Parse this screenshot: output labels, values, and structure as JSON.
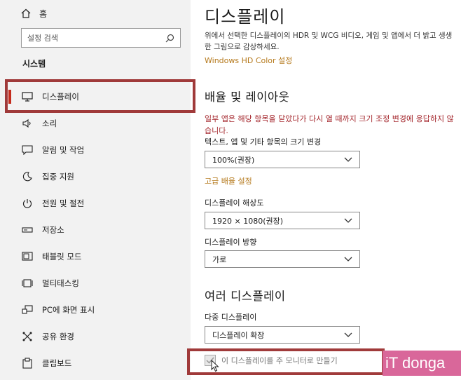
{
  "sidebar": {
    "home_label": "홈",
    "search_placeholder": "설정 검색",
    "section_title": "시스템",
    "items": [
      {
        "label": "디스플레이",
        "icon": "monitor-icon"
      },
      {
        "label": "소리",
        "icon": "speaker-icon"
      },
      {
        "label": "알림 및 작업",
        "icon": "notification-icon"
      },
      {
        "label": "집중 지원",
        "icon": "moon-icon"
      },
      {
        "label": "전원 및 절전",
        "icon": "power-icon"
      },
      {
        "label": "저장소",
        "icon": "storage-icon"
      },
      {
        "label": "태블릿 모드",
        "icon": "tablet-icon"
      },
      {
        "label": "멀티태스킹",
        "icon": "multitask-icon"
      },
      {
        "label": "PC에 화면 표시",
        "icon": "project-icon"
      },
      {
        "label": "공유 환경",
        "icon": "share-icon"
      },
      {
        "label": "클립보드",
        "icon": "clipboard-icon"
      }
    ]
  },
  "main": {
    "title": "디스플레이",
    "description": "위에서 선택한 디스플레이의 HDR 및 WCG 비디오, 게임 및 앱에서 더 밝고 생생한 그림으로 감상하세요.",
    "hd_color_link": "Windows HD Color 설정",
    "scale_section_title": "배율 및 레이아웃",
    "warning": "일부 앱은 해당 항목을 닫았다가 다시 열 때까지 크기 조정 변경에 응답하지 않습니다.",
    "text_size_label": "텍스트, 앱 및 기타 항목의 크기 변경",
    "text_size_value": "100%(권장)",
    "advanced_scale_link": "고급 배율 설정",
    "resolution_label": "디스플레이 해상도",
    "resolution_value": "1920 × 1080(권장)",
    "orientation_label": "디스플레이 방향",
    "orientation_value": "가로",
    "multi_section_title": "여러 디스플레이",
    "multi_label": "다중 디스플레이",
    "multi_value": "디스플레이 확장",
    "main_display_checkbox": "이 디스플레이를 주 모니터로 만들기"
  },
  "watermark": "iT donga",
  "colors": {
    "accent": "#b5791c",
    "warning": "#a4262c",
    "highlight": "#a03a3a",
    "sidebar_bg": "#f2f2f2"
  }
}
